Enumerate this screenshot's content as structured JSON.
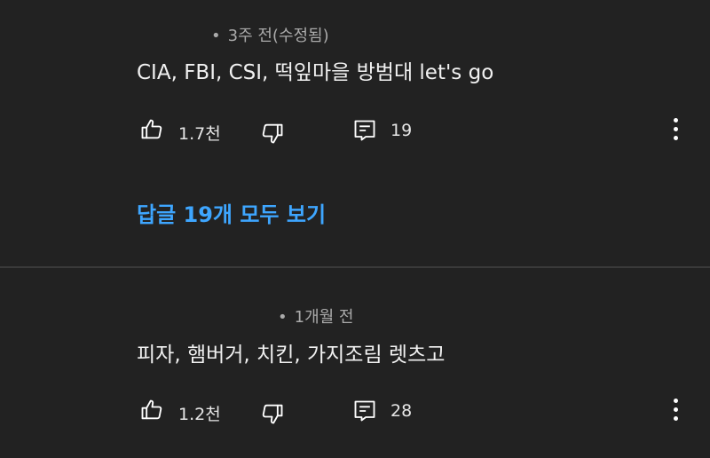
{
  "comments": [
    {
      "time": "3주 전(수정됨)",
      "text": "CIA, FBI, CSI, 떡잎마을 방범대 let's go",
      "likes": "1.7천",
      "replies_count": "19",
      "replies_link": "답글 19개 모두 보기"
    },
    {
      "time": "1개월 전",
      "text": "피자, 햄버거, 치킨, 가지조림 렛츠고",
      "likes": "1.2천",
      "replies_count": "28"
    }
  ],
  "dot": "•",
  "icons": {
    "like": "thumb-up-icon",
    "dislike": "thumb-down-icon",
    "reply": "comment-icon",
    "more": "more-vertical-icon"
  },
  "colors": {
    "background": "#222222",
    "link": "#3ea6ff",
    "meta": "#aaaaaa",
    "divider": "#3a3a3a"
  }
}
